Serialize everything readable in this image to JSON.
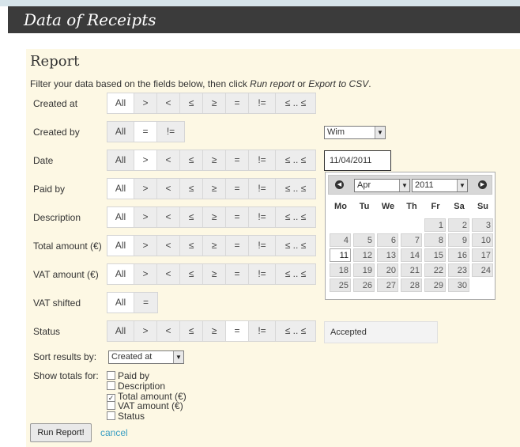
{
  "header": {
    "title": "Data of Receipts"
  },
  "report": {
    "title": "Report",
    "intro_pre": "Filter your data based on the fields below, then click ",
    "intro_run": "Run report",
    "intro_mid": " or ",
    "intro_export": "Export to CSV",
    "intro_end": "."
  },
  "ops": {
    "all": "All",
    "gt": ">",
    "lt": "<",
    "le": "≤",
    "ge": "≥",
    "eq": "=",
    "ne": "!=",
    "between": "≤ .. ≤"
  },
  "rows": {
    "created_at": "Created at",
    "created_by": "Created by",
    "date": "Date",
    "paid_by": "Paid by",
    "description": "Description",
    "total_amount": "Total amount (€)",
    "vat_amount": "VAT amount (€)",
    "vat_shifted": "VAT shifted",
    "status": "Status"
  },
  "created_by_select": {
    "value": "Wim"
  },
  "date_input": {
    "value": "11/04/2011"
  },
  "status_value": "Accepted",
  "calendar": {
    "month": "Apr",
    "year": "2011",
    "weekdays": [
      "Mo",
      "Tu",
      "We",
      "Th",
      "Fr",
      "Sa",
      "Su"
    ],
    "weeks": [
      [
        "",
        "",
        "",
        "",
        "1",
        "2",
        "3"
      ],
      [
        "4",
        "5",
        "6",
        "7",
        "8",
        "9",
        "10"
      ],
      [
        "11",
        "12",
        "13",
        "14",
        "15",
        "16",
        "17"
      ],
      [
        "18",
        "19",
        "20",
        "21",
        "22",
        "23",
        "24"
      ],
      [
        "25",
        "26",
        "27",
        "28",
        "29",
        "30",
        ""
      ]
    ],
    "today": "11"
  },
  "sort": {
    "label": "Sort results by:",
    "value": "Created at"
  },
  "totals": {
    "label": "Show totals for:",
    "options": [
      {
        "label": "Paid by",
        "checked": false
      },
      {
        "label": "Description",
        "checked": false
      },
      {
        "label": "Total amount (€)",
        "checked": true
      },
      {
        "label": "VAT amount (€)",
        "checked": false
      },
      {
        "label": "Status",
        "checked": false
      }
    ]
  },
  "actions": {
    "run": "Run Report!",
    "cancel": "cancel"
  }
}
